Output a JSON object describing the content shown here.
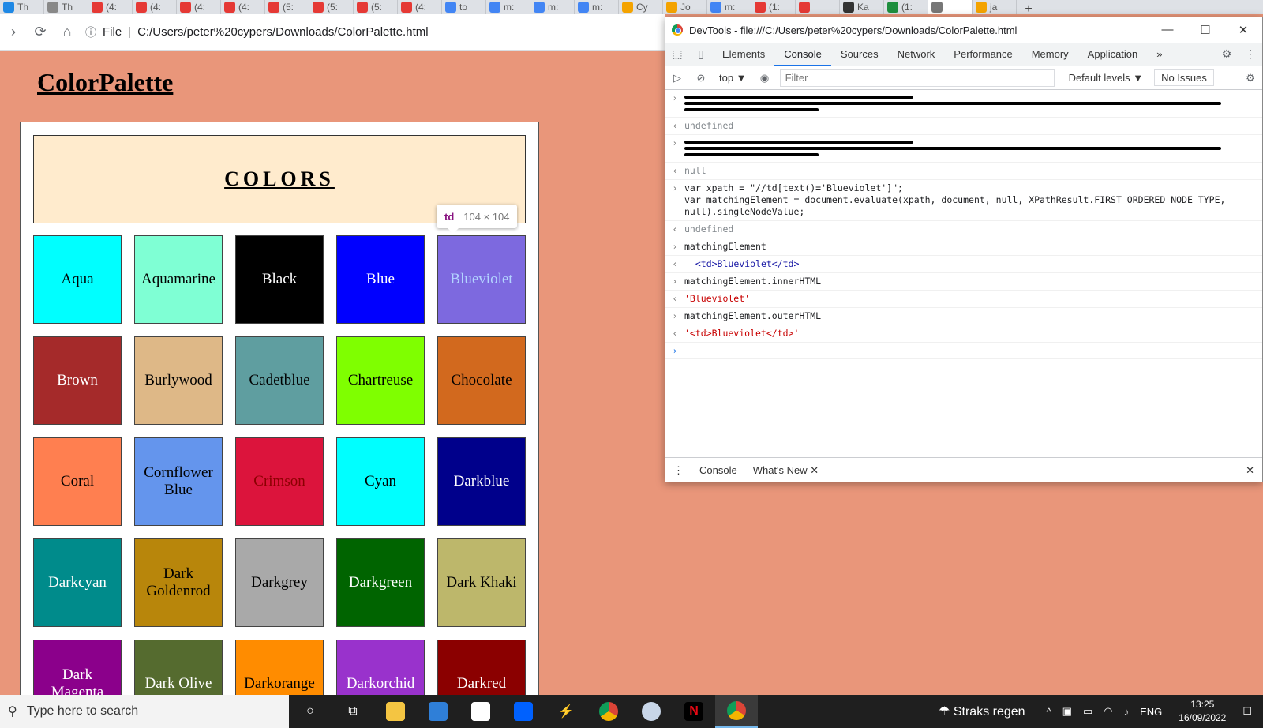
{
  "tabs": [
    "Th",
    "Th",
    "(4:",
    "(4:",
    "(4:",
    "(4:",
    "(5:",
    "(5:",
    "(5:",
    "(4:",
    "to",
    "m:",
    "m:",
    "m:",
    "Cy",
    "Jo",
    "m:",
    "(1:",
    "",
    "Ka",
    "(1:",
    "",
    "ja"
  ],
  "address": {
    "scheme": "File",
    "url": "C:/Users/peter%20cypers/Downloads/ColorPalette.html"
  },
  "page": {
    "title": "ColorPalette",
    "header": "COLORS",
    "colors": [
      {
        "name": "Aqua",
        "bg": "#00ffff",
        "fg": "#000000"
      },
      {
        "name": "Aquamarine",
        "bg": "#7fffd4",
        "fg": "#000000"
      },
      {
        "name": "Black",
        "bg": "#000000",
        "fg": "#ffffff"
      },
      {
        "name": "Blue",
        "bg": "#0000ff",
        "fg": "#ffffff"
      },
      {
        "name": "Blueviolet",
        "bg": "#8a2be2",
        "fg": "#ffffff"
      },
      {
        "name": "Brown",
        "bg": "#a52a2a",
        "fg": "#ffffff"
      },
      {
        "name": "Burlywood",
        "bg": "#deb887",
        "fg": "#000000"
      },
      {
        "name": "Cadetblue",
        "bg": "#5f9ea0",
        "fg": "#000000"
      },
      {
        "name": "Chartreuse",
        "bg": "#7fff00",
        "fg": "#000000"
      },
      {
        "name": "Chocolate",
        "bg": "#d2691e",
        "fg": "#000000"
      },
      {
        "name": "Coral",
        "bg": "#ff7f50",
        "fg": "#000000"
      },
      {
        "name": "Cornflower Blue",
        "bg": "#6495ed",
        "fg": "#000000"
      },
      {
        "name": "Crimson",
        "bg": "#dc143c",
        "fg": "#8b0000"
      },
      {
        "name": "Cyan",
        "bg": "#00ffff",
        "fg": "#000000"
      },
      {
        "name": "Darkblue",
        "bg": "#00008b",
        "fg": "#ffffff"
      },
      {
        "name": "Darkcyan",
        "bg": "#008b8b",
        "fg": "#ffffff"
      },
      {
        "name": "Dark Goldenrod",
        "bg": "#b8860b",
        "fg": "#000000"
      },
      {
        "name": "Darkgrey",
        "bg": "#a9a9a9",
        "fg": "#000000"
      },
      {
        "name": "Darkgreen",
        "bg": "#006400",
        "fg": "#ffffff"
      },
      {
        "name": "Dark Khaki",
        "bg": "#bdb76b",
        "fg": "#000000"
      },
      {
        "name": "Dark Magenta",
        "bg": "#8b008b",
        "fg": "#ffffff"
      },
      {
        "name": "Dark Olive",
        "bg": "#556b2f",
        "fg": "#ffffff"
      },
      {
        "name": "Darkorange",
        "bg": "#ff8c00",
        "fg": "#000000"
      },
      {
        "name": "Darkorchid",
        "bg": "#9932cc",
        "fg": "#ffffff"
      },
      {
        "name": "Darkred",
        "bg": "#8b0000",
        "fg": "#ffffff"
      }
    ],
    "highlighted": "Blueviolet",
    "tooltip": {
      "tag": "td",
      "dims": "104 × 104"
    }
  },
  "devtools": {
    "title": "DevTools - file:///C:/Users/peter%20cypers/Downloads/ColorPalette.html",
    "tabs": [
      "Elements",
      "Console",
      "Sources",
      "Network",
      "Performance",
      "Memory",
      "Application"
    ],
    "active_tab": "Console",
    "more": "»",
    "context": "top ▼",
    "filter_placeholder": "Filter",
    "levels": "Default levels ▼",
    "issues": "No Issues",
    "lines": [
      {
        "type": "redacted"
      },
      {
        "type": "output",
        "text": "undefined",
        "cls": "val-undef"
      },
      {
        "type": "redacted"
      },
      {
        "type": "output",
        "text": "null",
        "cls": "val-undef"
      },
      {
        "type": "input",
        "text": "var xpath = \"//td[text()='Blueviolet']\";\nvar matchingElement = document.evaluate(xpath, document, null, XPathResult.FIRST_ORDERED_NODE_TYPE,\nnull).singleNodeValue;"
      },
      {
        "type": "output",
        "text": "undefined",
        "cls": "val-undef"
      },
      {
        "type": "input",
        "text": "matchingElement"
      },
      {
        "type": "output",
        "text": "  <td>Blueviolet</td>",
        "cls": "val-kw"
      },
      {
        "type": "input",
        "text": "matchingElement.innerHTML"
      },
      {
        "type": "output",
        "text": "'Blueviolet'",
        "cls": "val-str"
      },
      {
        "type": "input",
        "text": "matchingElement.outerHTML"
      },
      {
        "type": "output",
        "text": "'<td>Blueviolet</td>'",
        "cls": "val-str"
      },
      {
        "type": "prompt",
        "text": ""
      }
    ],
    "drawer": {
      "console": "Console",
      "whats_new": "What's New"
    }
  },
  "taskbar": {
    "search_placeholder": "Type here to search",
    "weather": "Straks regen",
    "lang": "ENG",
    "time": "13:25",
    "date": "16/09/2022"
  }
}
